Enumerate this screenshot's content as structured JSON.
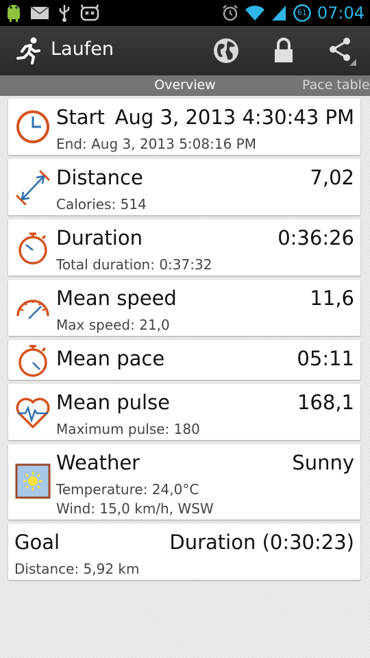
{
  "status_bar": {
    "time": "07:04",
    "battery": "61",
    "icons": [
      "android-debug-icon",
      "mail-icon",
      "usb-icon",
      "cyanogen-icon",
      "alarm-icon",
      "wifi-icon",
      "signal-icon",
      "battery-icon"
    ]
  },
  "action_bar": {
    "title": "Laufen",
    "app_icon": "runner-icon",
    "actions": [
      "globe-icon",
      "lock-icon",
      "share-icon"
    ]
  },
  "tabs": [
    {
      "label": "Overview",
      "selected": true
    },
    {
      "label": "Pace table",
      "selected": false
    }
  ],
  "cards": {
    "start": {
      "icon": "clock-icon",
      "title": "Start",
      "value": "Aug 3, 2013 4:30:43 PM",
      "sub": "End: Aug 3, 2013 5:08:16 PM"
    },
    "distance": {
      "icon": "distance-arrow-icon",
      "title": "Distance",
      "value": "7,02",
      "sub": "Calories: 514"
    },
    "duration": {
      "icon": "stopwatch-icon",
      "title": "Duration",
      "value": "0:36:26",
      "sub": "Total duration: 0:37:32"
    },
    "mean_speed": {
      "icon": "speedometer-icon",
      "title": "Mean speed",
      "value": "11,6",
      "sub": "Max speed: 21,0"
    },
    "mean_pace": {
      "icon": "stopwatch-icon",
      "title": "Mean pace",
      "value": "05:11"
    },
    "mean_pulse": {
      "icon": "heart-pulse-icon",
      "title": "Mean pulse",
      "value": "168,1",
      "sub": "Maximum pulse: 180"
    },
    "weather": {
      "icon": "sun-icon",
      "title": "Weather",
      "value": "Sunny",
      "sub1": "Temperature: 24,0°C",
      "sub2": "Wind: 15,0 km/h, WSW"
    },
    "goal": {
      "title": "Goal",
      "value": "Duration (0:30:23)",
      "sub": "Distance: 5,92 km"
    }
  },
  "colors": {
    "accent_orange": "#d4531f",
    "accent_blue": "#2c6fb0",
    "status_blue": "#2fb5e6"
  }
}
